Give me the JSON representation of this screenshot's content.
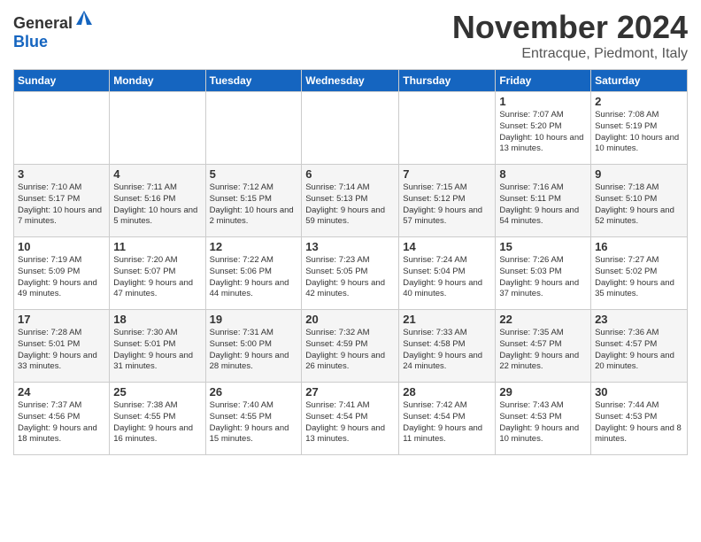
{
  "header": {
    "logo_line1": "General",
    "logo_line2": "Blue",
    "month_title": "November 2024",
    "location": "Entracque, Piedmont, Italy"
  },
  "weekdays": [
    "Sunday",
    "Monday",
    "Tuesday",
    "Wednesday",
    "Thursday",
    "Friday",
    "Saturday"
  ],
  "weeks": [
    [
      {
        "day": "",
        "info": ""
      },
      {
        "day": "",
        "info": ""
      },
      {
        "day": "",
        "info": ""
      },
      {
        "day": "",
        "info": ""
      },
      {
        "day": "",
        "info": ""
      },
      {
        "day": "1",
        "info": "Sunrise: 7:07 AM\nSunset: 5:20 PM\nDaylight: 10 hours and 13 minutes."
      },
      {
        "day": "2",
        "info": "Sunrise: 7:08 AM\nSunset: 5:19 PM\nDaylight: 10 hours and 10 minutes."
      }
    ],
    [
      {
        "day": "3",
        "info": "Sunrise: 7:10 AM\nSunset: 5:17 PM\nDaylight: 10 hours and 7 minutes."
      },
      {
        "day": "4",
        "info": "Sunrise: 7:11 AM\nSunset: 5:16 PM\nDaylight: 10 hours and 5 minutes."
      },
      {
        "day": "5",
        "info": "Sunrise: 7:12 AM\nSunset: 5:15 PM\nDaylight: 10 hours and 2 minutes."
      },
      {
        "day": "6",
        "info": "Sunrise: 7:14 AM\nSunset: 5:13 PM\nDaylight: 9 hours and 59 minutes."
      },
      {
        "day": "7",
        "info": "Sunrise: 7:15 AM\nSunset: 5:12 PM\nDaylight: 9 hours and 57 minutes."
      },
      {
        "day": "8",
        "info": "Sunrise: 7:16 AM\nSunset: 5:11 PM\nDaylight: 9 hours and 54 minutes."
      },
      {
        "day": "9",
        "info": "Sunrise: 7:18 AM\nSunset: 5:10 PM\nDaylight: 9 hours and 52 minutes."
      }
    ],
    [
      {
        "day": "10",
        "info": "Sunrise: 7:19 AM\nSunset: 5:09 PM\nDaylight: 9 hours and 49 minutes."
      },
      {
        "day": "11",
        "info": "Sunrise: 7:20 AM\nSunset: 5:07 PM\nDaylight: 9 hours and 47 minutes."
      },
      {
        "day": "12",
        "info": "Sunrise: 7:22 AM\nSunset: 5:06 PM\nDaylight: 9 hours and 44 minutes."
      },
      {
        "day": "13",
        "info": "Sunrise: 7:23 AM\nSunset: 5:05 PM\nDaylight: 9 hours and 42 minutes."
      },
      {
        "day": "14",
        "info": "Sunrise: 7:24 AM\nSunset: 5:04 PM\nDaylight: 9 hours and 40 minutes."
      },
      {
        "day": "15",
        "info": "Sunrise: 7:26 AM\nSunset: 5:03 PM\nDaylight: 9 hours and 37 minutes."
      },
      {
        "day": "16",
        "info": "Sunrise: 7:27 AM\nSunset: 5:02 PM\nDaylight: 9 hours and 35 minutes."
      }
    ],
    [
      {
        "day": "17",
        "info": "Sunrise: 7:28 AM\nSunset: 5:01 PM\nDaylight: 9 hours and 33 minutes."
      },
      {
        "day": "18",
        "info": "Sunrise: 7:30 AM\nSunset: 5:01 PM\nDaylight: 9 hours and 31 minutes."
      },
      {
        "day": "19",
        "info": "Sunrise: 7:31 AM\nSunset: 5:00 PM\nDaylight: 9 hours and 28 minutes."
      },
      {
        "day": "20",
        "info": "Sunrise: 7:32 AM\nSunset: 4:59 PM\nDaylight: 9 hours and 26 minutes."
      },
      {
        "day": "21",
        "info": "Sunrise: 7:33 AM\nSunset: 4:58 PM\nDaylight: 9 hours and 24 minutes."
      },
      {
        "day": "22",
        "info": "Sunrise: 7:35 AM\nSunset: 4:57 PM\nDaylight: 9 hours and 22 minutes."
      },
      {
        "day": "23",
        "info": "Sunrise: 7:36 AM\nSunset: 4:57 PM\nDaylight: 9 hours and 20 minutes."
      }
    ],
    [
      {
        "day": "24",
        "info": "Sunrise: 7:37 AM\nSunset: 4:56 PM\nDaylight: 9 hours and 18 minutes."
      },
      {
        "day": "25",
        "info": "Sunrise: 7:38 AM\nSunset: 4:55 PM\nDaylight: 9 hours and 16 minutes."
      },
      {
        "day": "26",
        "info": "Sunrise: 7:40 AM\nSunset: 4:55 PM\nDaylight: 9 hours and 15 minutes."
      },
      {
        "day": "27",
        "info": "Sunrise: 7:41 AM\nSunset: 4:54 PM\nDaylight: 9 hours and 13 minutes."
      },
      {
        "day": "28",
        "info": "Sunrise: 7:42 AM\nSunset: 4:54 PM\nDaylight: 9 hours and 11 minutes."
      },
      {
        "day": "29",
        "info": "Sunrise: 7:43 AM\nSunset: 4:53 PM\nDaylight: 9 hours and 10 minutes."
      },
      {
        "day": "30",
        "info": "Sunrise: 7:44 AM\nSunset: 4:53 PM\nDaylight: 9 hours and 8 minutes."
      }
    ]
  ]
}
